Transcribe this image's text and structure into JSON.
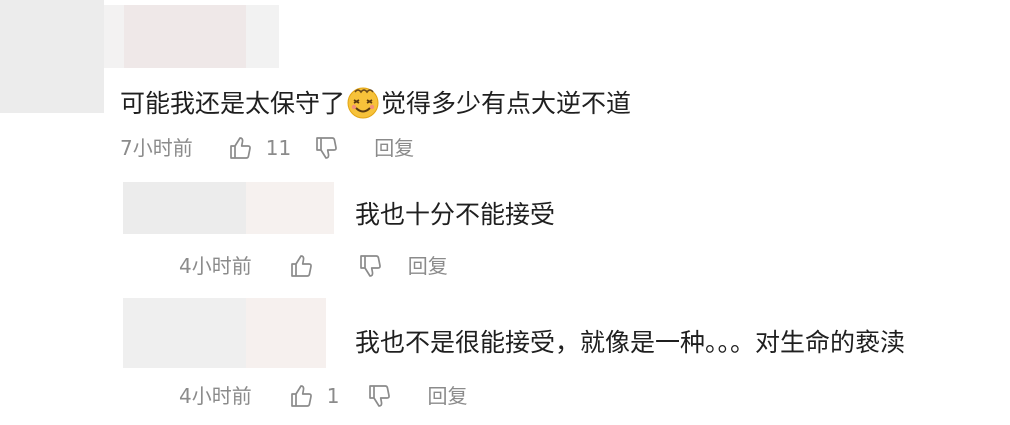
{
  "comments": [
    {
      "text_before_emoji": "可能我还是太保守了",
      "emoji": "dizzy-face-emoji",
      "text_after_emoji": "觉得多少有点大逆不道",
      "time": "7小时前",
      "like_count": "11",
      "reply_label": "回复"
    },
    {
      "text": "我也十分不能接受",
      "time": "4小时前",
      "like_count": "",
      "reply_label": "回复"
    },
    {
      "text": "我也不是很能接受，就像是一种。。。对生命的亵渎",
      "time": "4小时前",
      "like_count": "1",
      "reply_label": "回复"
    }
  ],
  "colors": {
    "text": "#1f1f1f",
    "meta": "#8b8b8b",
    "blur_light": "#eeeeee",
    "blur_pink": "#f5eeed"
  },
  "icons": [
    "thumb-up-icon",
    "thumb-down-icon",
    "dizzy-face-emoji"
  ]
}
